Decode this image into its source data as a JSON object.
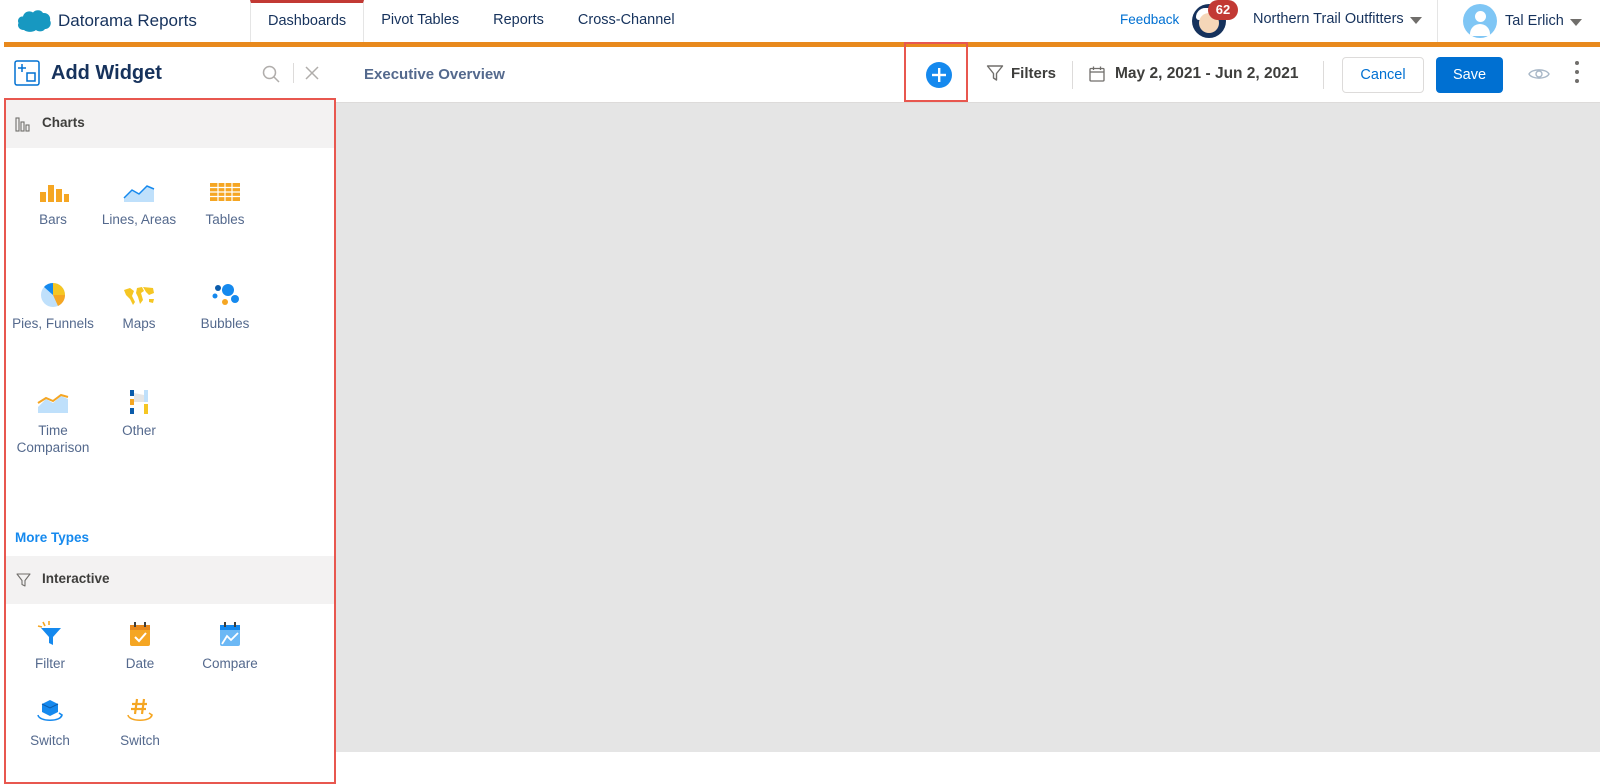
{
  "app": {
    "brand_name": "Datorama Reports"
  },
  "nav": {
    "tabs": [
      {
        "label": "Dashboards",
        "active": true
      },
      {
        "label": "Pivot Tables"
      },
      {
        "label": "Reports"
      },
      {
        "label": "Cross-Channel"
      }
    ],
    "feedback": "Feedback",
    "notification_count": "62",
    "org_name": "Northern Trail Outfitters",
    "user_name": "Tal Erlich"
  },
  "panel": {
    "title": "Add Widget",
    "charts_section": {
      "label": "Charts",
      "items": [
        {
          "label": "Bars",
          "icon": "bar-chart-icon"
        },
        {
          "label": "Lines, Areas",
          "icon": "area-chart-icon"
        },
        {
          "label": "Tables",
          "icon": "table-icon"
        },
        {
          "label": "Pies, Funnels",
          "icon": "pie-chart-icon"
        },
        {
          "label": "Maps",
          "icon": "world-map-icon"
        },
        {
          "label": "Bubbles",
          "icon": "bubbles-icon"
        },
        {
          "label": "Time Comparison",
          "icon": "time-comparison-icon"
        },
        {
          "label": "Other",
          "icon": "other-chart-icon"
        }
      ],
      "more_types": "More Types"
    },
    "interactive_section": {
      "label": "Interactive",
      "items": [
        {
          "label": "Filter",
          "icon": "filter-widget-icon"
        },
        {
          "label": "Date",
          "icon": "date-widget-icon"
        },
        {
          "label": "Compare",
          "icon": "compare-widget-icon"
        },
        {
          "label": "Switch",
          "icon": "dimension-switch-icon"
        },
        {
          "label": "Switch",
          "icon": "measurement-switch-icon"
        }
      ]
    }
  },
  "toolbar": {
    "page_title": "Executive Overview",
    "filters_label": "Filters",
    "date_range": "May 2, 2021 - Jun 2, 2021",
    "cancel_label": "Cancel",
    "save_label": "Save"
  },
  "colors": {
    "accent_orange": "#e8891d",
    "primary_blue": "#0070d2",
    "highlight_red": "#e8574f",
    "canvas_gray": "#e5e5e5"
  }
}
